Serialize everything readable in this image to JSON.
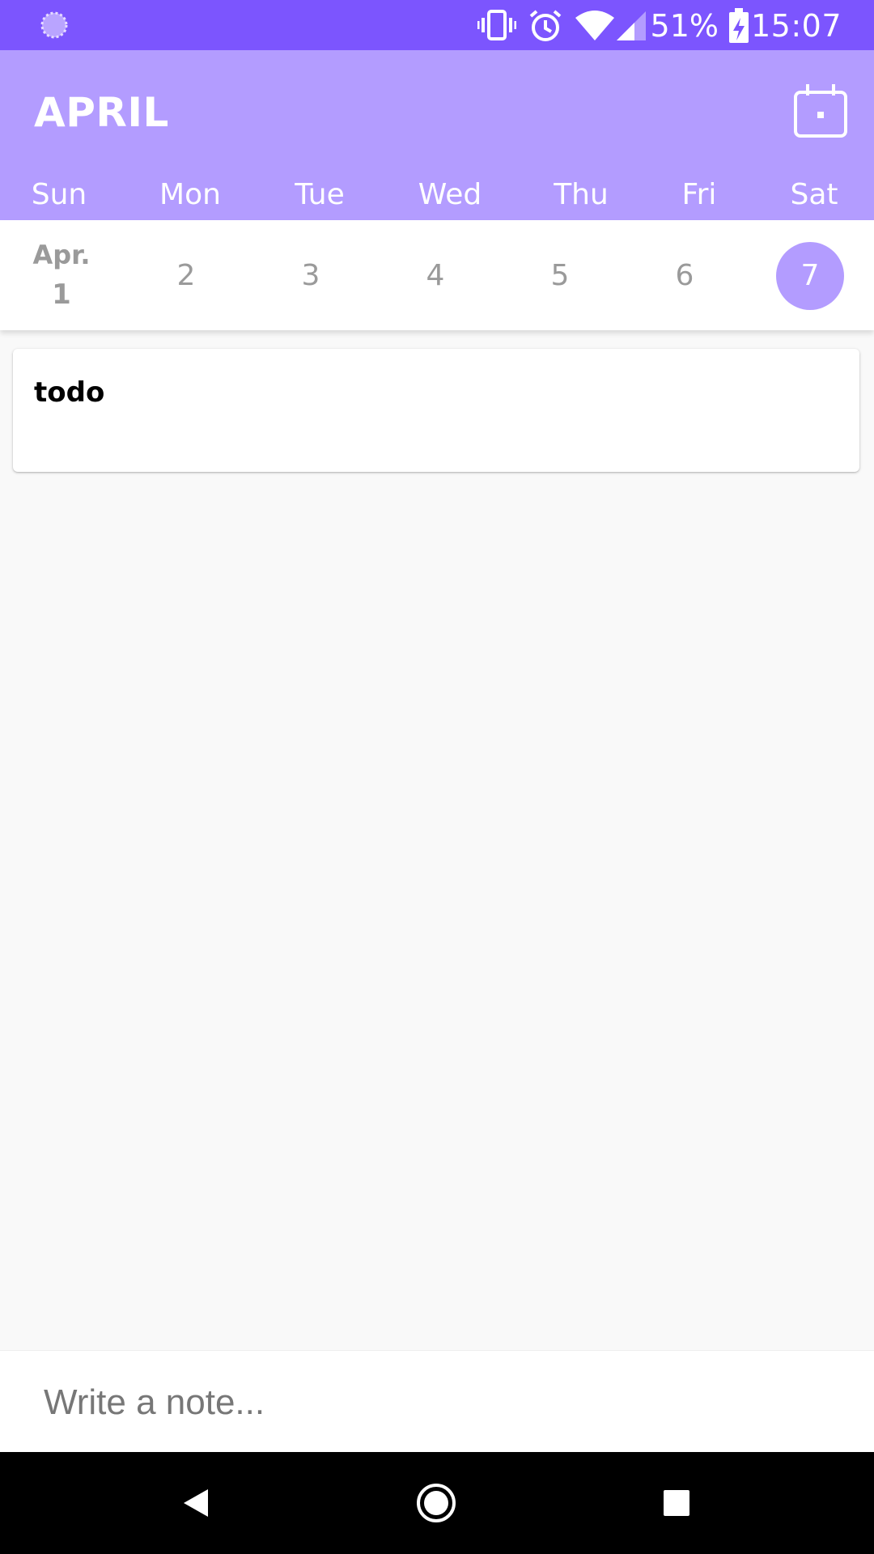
{
  "status_bar": {
    "battery_percent": "51%",
    "time": "15:07",
    "icons": [
      "loading-icon",
      "vibrate-icon",
      "alarm-icon",
      "wifi-icon",
      "signal-icon",
      "battery-charging-icon"
    ]
  },
  "header": {
    "month": "APRIL",
    "calendar_icon": "calendar-icon",
    "weekdays": [
      "Sun",
      "Mon",
      "Tue",
      "Wed",
      "Thu",
      "Fri",
      "Sat"
    ]
  },
  "date_strip": {
    "first_month": "Apr.",
    "first_day": "1",
    "days": [
      "2",
      "3",
      "4",
      "5",
      "6"
    ],
    "selected": "7"
  },
  "notes": [
    {
      "title": "todo"
    }
  ],
  "input": {
    "placeholder": "Write a note..."
  },
  "nav_bar": {
    "back_icon": "back-icon",
    "home_icon": "home-icon",
    "recents_icon": "recents-icon"
  },
  "colors": {
    "status_bar": "#7c55fe",
    "header": "#b39cff",
    "selected_day": "#b39cff"
  }
}
